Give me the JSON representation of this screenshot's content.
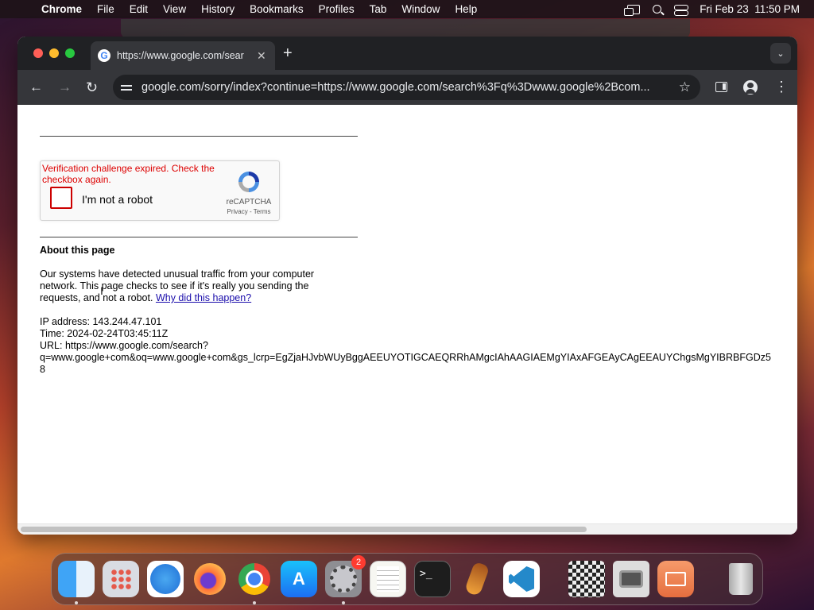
{
  "menubar": {
    "app_name": "Chrome",
    "items": [
      "File",
      "Edit",
      "View",
      "History",
      "Bookmarks",
      "Profiles",
      "Tab",
      "Window",
      "Help"
    ],
    "datetime": "Fri Feb 23  11:50 PM"
  },
  "browser": {
    "tab_title": "https://www.google.com/sear",
    "tab_favicon": "G",
    "new_tab_symbol": "+",
    "url": "google.com/sorry/index?continue=https://www.google.com/search%3Fq%3Dwww.google%2Bcom..."
  },
  "page": {
    "recaptcha": {
      "error_message": "Verification challenge expired. Check the checkbox again.",
      "checkbox_label": "I'm not a robot",
      "brand": "reCAPTCHA",
      "links": "Privacy - Terms",
      "checked": false
    },
    "about_title": "About this page",
    "about_text": "Our systems have detected unusual traffic from your computer network. This page checks to see if it's really you sending the requests, and not a robot.",
    "about_link": "Why did this happen?",
    "ip_line": "IP address: 143.244.47.101",
    "time_line": "Time: 2024-02-24T03:45:11Z",
    "url_line": "URL: https://www.google.com/search?",
    "url_query": "q=www.google+com&oq=www.google+com&gs_lcrp=EgZjaHJvbWUyBggAEEUYOTIGCAEQRRhAMgcIAhAAGIAEMgYIAxAFGEAyCAgEEAUYChgsMgYIBRBFGDz5",
    "url_tail": "8"
  },
  "dock": {
    "apps": [
      "Finder",
      "Launchpad",
      "Safari",
      "Firefox",
      "Chrome",
      "App Store",
      "System Settings",
      "TextEdit",
      "Terminal",
      "GarageBand",
      "VS Code",
      "Chess",
      "Photo Booth",
      "Screen Sharing",
      "Trash"
    ],
    "settings_badge": "2",
    "terminal_glyph": ">_",
    "appstore_glyph": "A"
  }
}
